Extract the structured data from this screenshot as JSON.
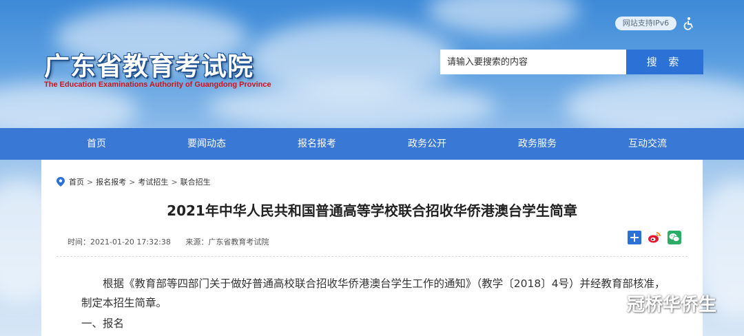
{
  "header": {
    "logo_cn": "广东省教育考试院",
    "logo_en": "The Education Examinations Authority of Guangdong Province",
    "ipv6_badge": "网站支持IPv6",
    "search_placeholder": "请输入要搜索的内容",
    "search_button": "搜 索"
  },
  "nav": {
    "items": [
      "首页",
      "要闻动态",
      "报名报考",
      "政务公开",
      "政务服务",
      "互动交流"
    ]
  },
  "breadcrumb": [
    "首页",
    "报名报考",
    "考试招生",
    "联合招生"
  ],
  "article": {
    "title": "2021年中华人民共和国普通高等学校联合招收华侨港澳台学生简章",
    "time": "时间：2021-01-20 17:32:38",
    "source": "来源：广东省教育考试院",
    "paragraph": "根据《教育部等四部门关于做好普通高校联合招收华侨港澳台学生工作的通知》（教学〔2018〕4号）并经教育部核准，制定本招生简章。",
    "section_1": "一、报名"
  },
  "watermark": "冠桥华侨生",
  "colors": {
    "nav_bg": "#3a78d6",
    "search_btn": "#2b71d6",
    "logo_en": "#c8161d"
  }
}
